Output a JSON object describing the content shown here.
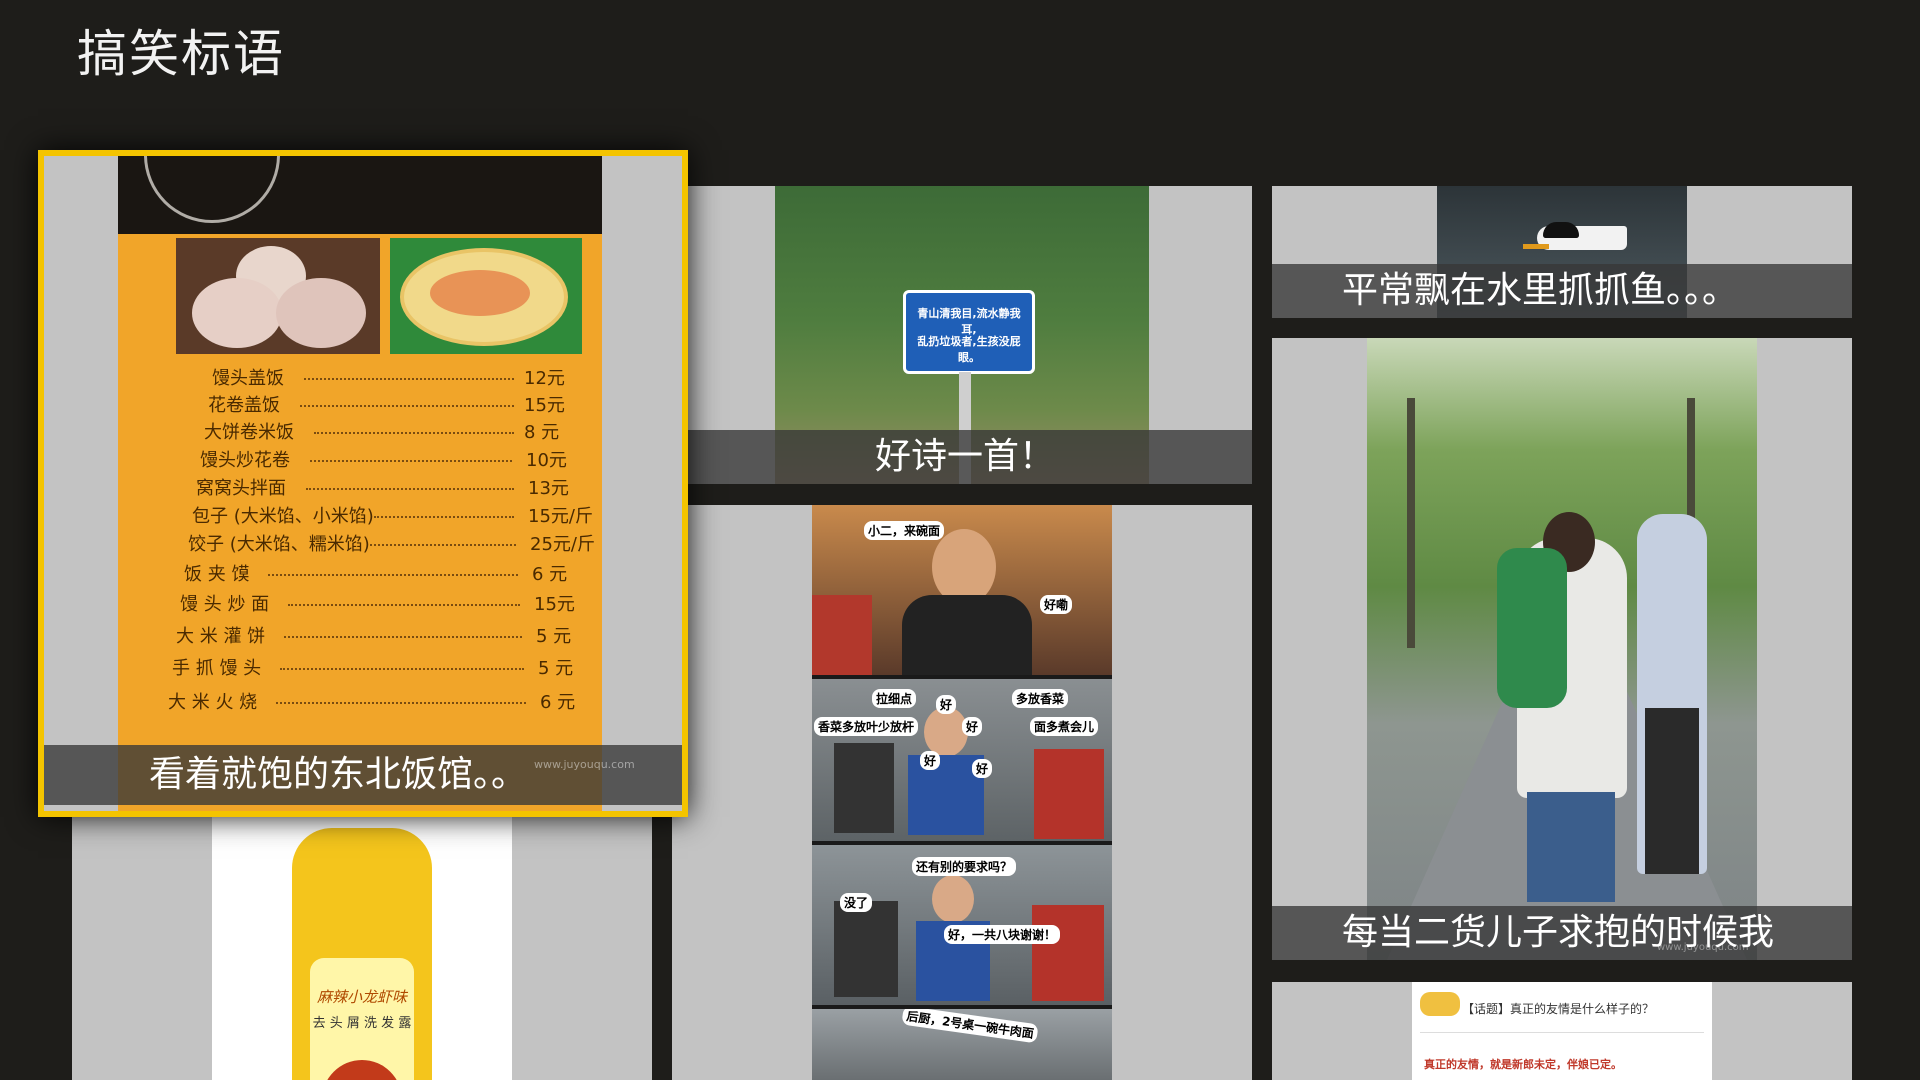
{
  "page": {
    "title": "搞笑标语"
  },
  "colors": {
    "background": "#1e1d1a",
    "selection_border": "#f4c400",
    "caption_bar": "#373737"
  },
  "tiles": {
    "menu": {
      "caption": "看着就饱的东北饭馆。。",
      "watermark": "www.juyouqu.com",
      "items": [
        {
          "name": "馒头盖饭",
          "price": "12元"
        },
        {
          "name": "花卷盖饭",
          "price": "15元"
        },
        {
          "name": "大饼卷米饭",
          "price": "8 元"
        },
        {
          "name": "馒头炒花卷",
          "price": "10元"
        },
        {
          "name": "窝窝头拌面",
          "price": "13元"
        },
        {
          "name": "包子 (大米馅、小米馅)",
          "price": "15元/斤"
        },
        {
          "name": "饺子 (大米馅、糯米馅)",
          "price": "25元/斤"
        },
        {
          "name": "饭 夹 馍",
          "price": "6 元"
        },
        {
          "name": "馒 头 炒 面",
          "price": "15元"
        },
        {
          "name": "大 米 灌 饼",
          "price": "5 元"
        },
        {
          "name": "手 抓 馒 头",
          "price": "5 元"
        },
        {
          "name": "大 米 火 烧",
          "price": "6 元"
        }
      ]
    },
    "poem": {
      "caption": "好诗一首！",
      "sign_line1": "青山清我目,流水静我耳,",
      "sign_line2": "乱扔垃圾者,生孩没屁眼。"
    },
    "fish": {
      "caption": "平常飘在水里抓抓鱼。。。"
    },
    "comic": {
      "panel1": [
        "小二，来碗面",
        "好嘞"
      ],
      "panel2": [
        "拉细点",
        "好",
        "多放香菜",
        "香菜多放叶少放杆",
        "好",
        "面多煮会儿",
        "好",
        "好"
      ],
      "panel3": [
        "还有别的要求吗？",
        "没了",
        "好，一共八块谢谢！"
      ],
      "panel4": [
        "后厨，2号桌一碗牛肉面"
      ]
    },
    "shampoo": {
      "line1": "麻辣小龙虾味",
      "line2": "去 头 屑 洗 发 露"
    },
    "park": {
      "caption": "每当二货儿子求抱的时候我",
      "watermark": "www.juyouqu.com"
    },
    "forum": {
      "header": "【话题】真正的友情是什么样子的？",
      "body": "真正的友情，就是新郎未定，伴娘已定。"
    }
  }
}
